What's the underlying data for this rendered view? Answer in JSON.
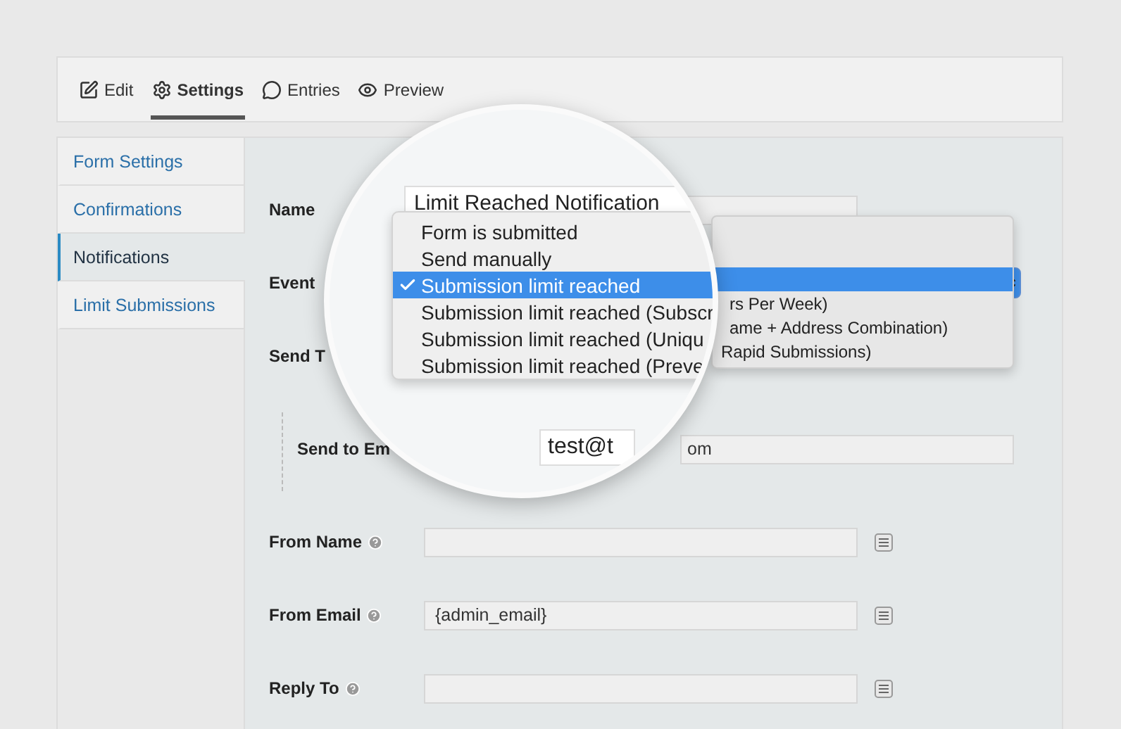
{
  "tabs": [
    {
      "label": "Edit",
      "selected": false
    },
    {
      "label": "Settings",
      "selected": true
    },
    {
      "label": "Entries",
      "selected": false
    },
    {
      "label": "Preview",
      "selected": false
    }
  ],
  "sidebar": {
    "items": [
      {
        "label": "Form Settings",
        "selected": false
      },
      {
        "label": "Confirmations",
        "selected": false
      },
      {
        "label": "Notifications",
        "selected": true
      },
      {
        "label": "Limit Submissions",
        "selected": false
      }
    ]
  },
  "fields": [
    {
      "kind": "text",
      "label": "Name"
    },
    {
      "kind": "select",
      "label": "Event"
    },
    {
      "kind": "label",
      "label": "Send T"
    },
    {
      "kind": "sub",
      "label": "Send to Em",
      "value": "om"
    },
    {
      "kind": "text",
      "label": "From Name",
      "help": true,
      "merge_tag": true
    },
    {
      "kind": "text",
      "label": "From Email",
      "value": "{admin_email}",
      "help": true,
      "merge_tag": true
    },
    {
      "kind": "text",
      "label": "Reply To",
      "help": true,
      "merge_tag": true
    }
  ],
  "event_menu_behind": {
    "items": [
      {
        "selected": true
      },
      {
        "label": "rs Per Week)",
        "selected": false
      },
      {
        "label": "ame + Address Combination)",
        "selected": false
      },
      {
        "label": "Rapid Submissions)",
        "selected": false
      }
    ]
  },
  "magnifier": {
    "name_value": "Limit Reached Notification",
    "event_menu": {
      "items": [
        {
          "label": "Form is submitted",
          "selected": false
        },
        {
          "label": "Send manually",
          "selected": false
        },
        {
          "label": "Submission limit reached",
          "selected": true
        },
        {
          "label": "Submission limit reached (Subscr",
          "selected": false
        },
        {
          "label": "Submission limit reached (Uniqu",
          "selected": false
        },
        {
          "label": "Submission limit reached (Preve",
          "selected": false
        }
      ]
    },
    "email_value": "test@t"
  }
}
